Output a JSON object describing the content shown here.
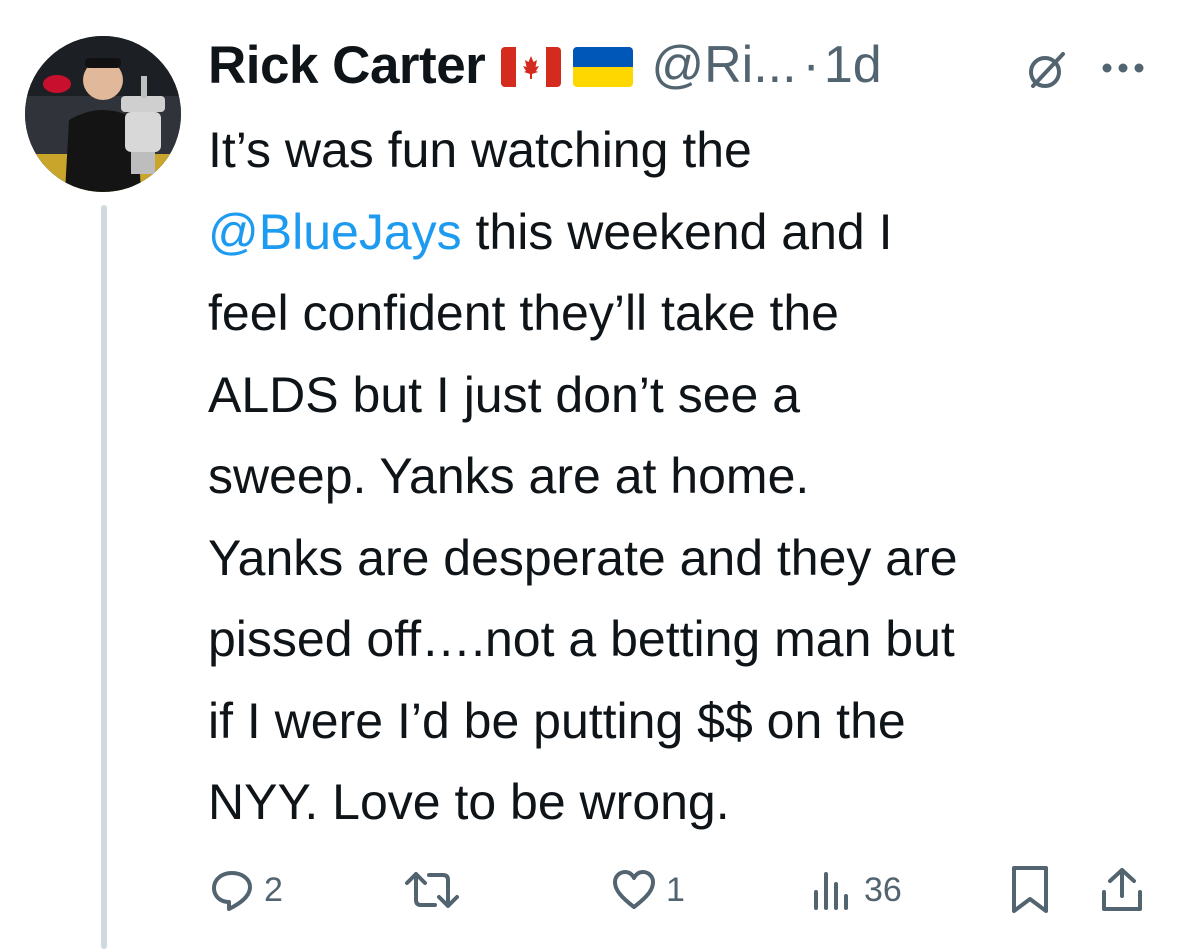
{
  "author": {
    "display_name": "Rick Carter",
    "flags": [
      "canada-flag-icon",
      "ukraine-flag-icon"
    ],
    "handle": "@Ri...",
    "separator": "·",
    "time": "1d"
  },
  "tweet": {
    "lines": [
      [
        "It’s was fun watching the"
      ],
      [
        "",
        "@BlueJays",
        " this weekend and I"
      ],
      [
        "feel confident they’ll take the"
      ],
      [
        "ALDS but I just don’t see a"
      ],
      [
        "sweep.  Yanks are at home."
      ],
      [
        "Yanks are desperate and they are"
      ],
      [
        "pissed off….not a betting man but"
      ],
      [
        "if I were I’d be putting $$ on the"
      ],
      [
        "NYY.  Love to be wrong."
      ]
    ],
    "mention": "@BlueJays",
    "line1": "It’s was fun watching the",
    "line2_after": " this weekend and I",
    "line3": "feel confident they’ll take the",
    "line4": "ALDS but I just don’t see a",
    "line5": "sweep.  Yanks are at home.",
    "line6": "Yanks are desperate and they are",
    "line7": "pissed off….not a betting man but",
    "line8": "if I were I’d be putting $$ on the",
    "line9": "NYY.  Love to be wrong."
  },
  "actions": {
    "reply_count": "2",
    "retweet_count": "",
    "like_count": "1",
    "views_count": "36"
  },
  "colors": {
    "text": "#0f1419",
    "secondary": "#536471",
    "link": "#1d9bf0",
    "thread_line": "#cfd9de"
  }
}
